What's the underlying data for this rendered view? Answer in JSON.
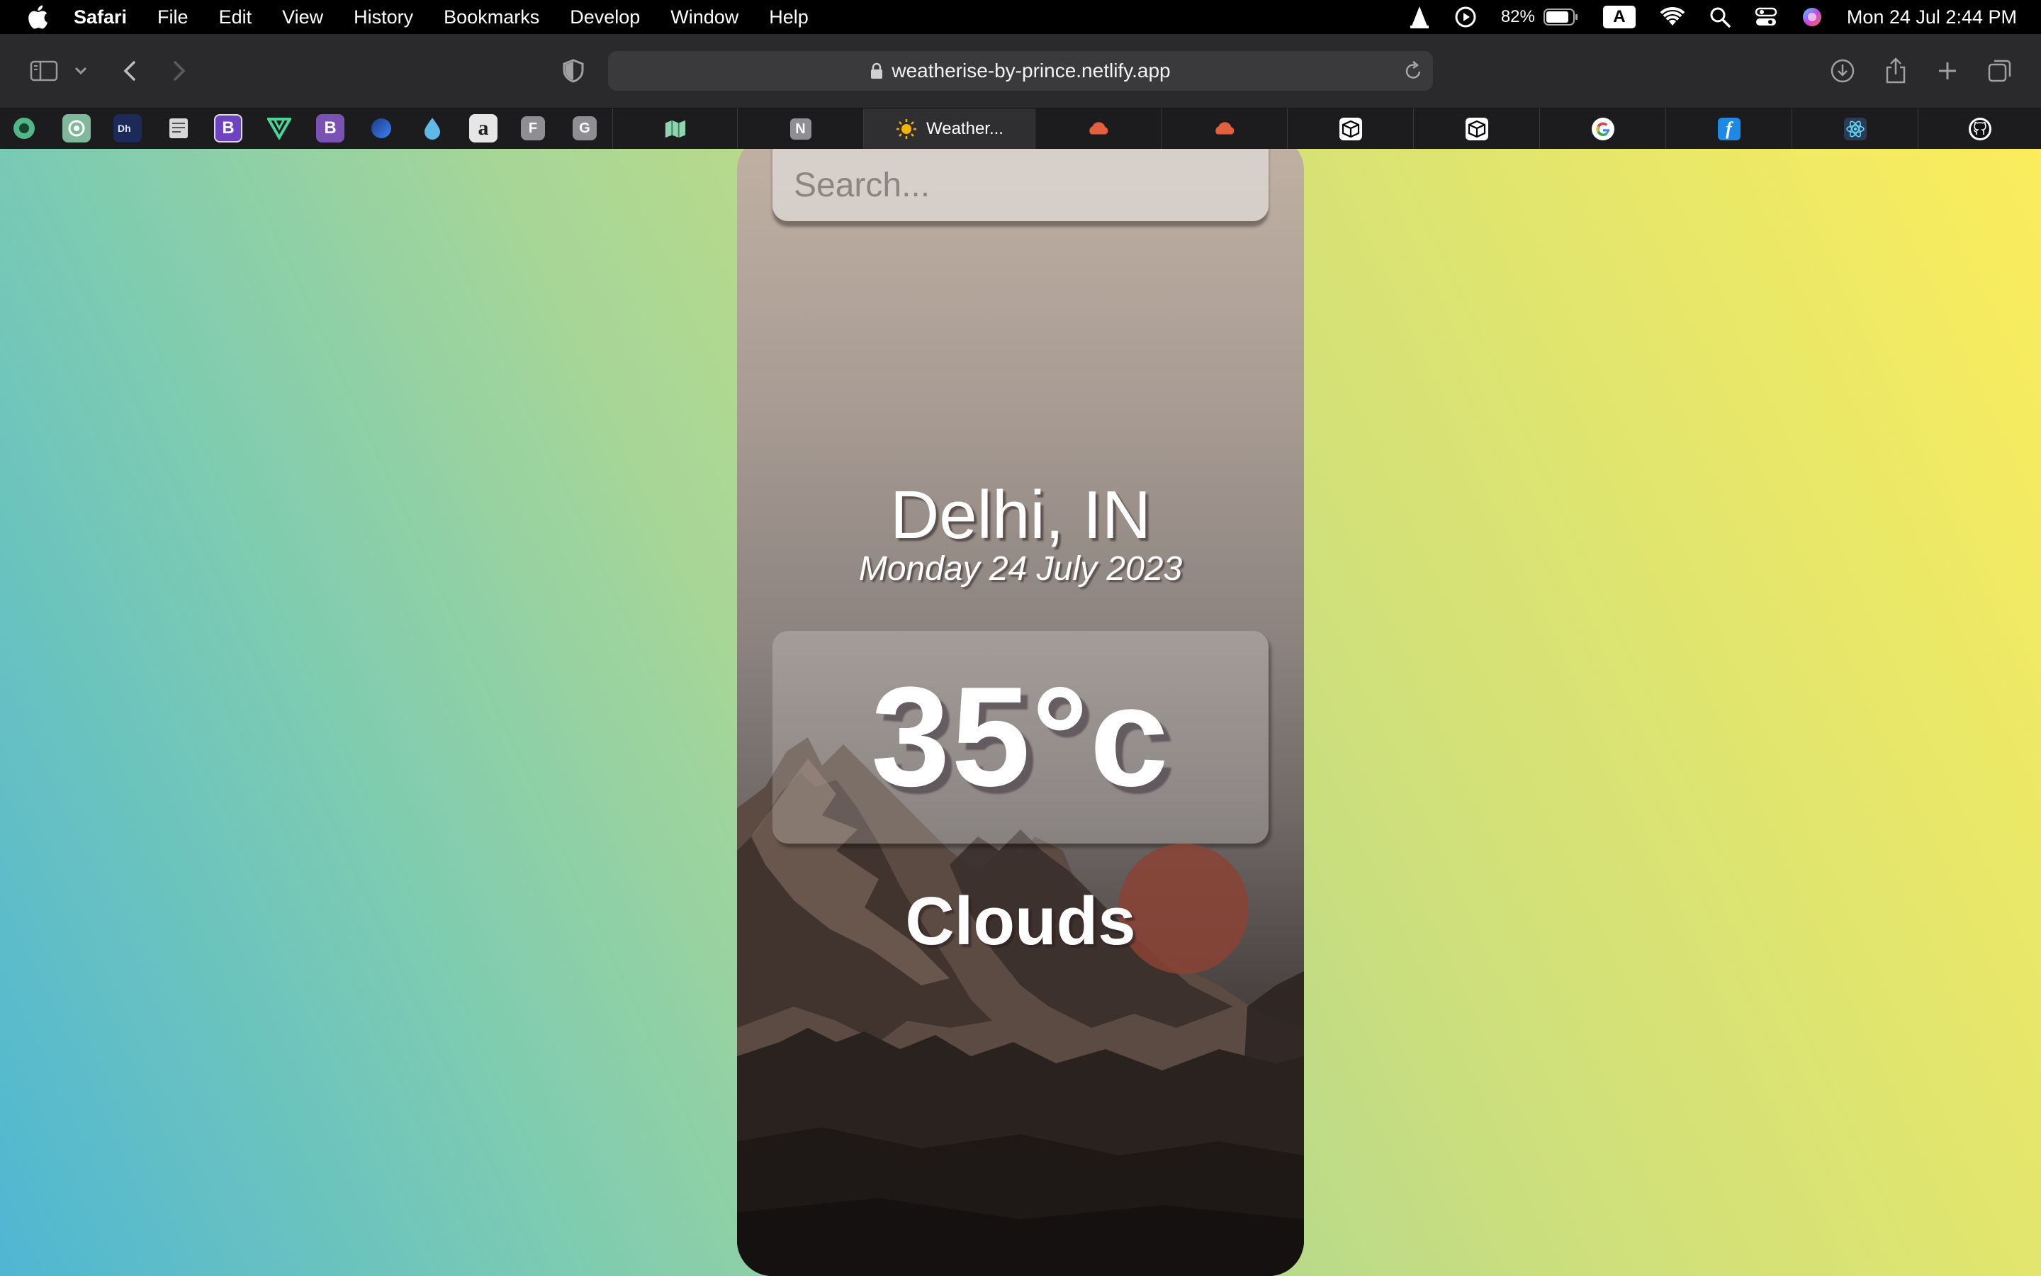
{
  "menubar": {
    "app": "Safari",
    "items": [
      "File",
      "Edit",
      "View",
      "History",
      "Bookmarks",
      "Develop",
      "Window",
      "Help"
    ],
    "battery": "82%",
    "input_source": "A",
    "clock": "Mon 24 Jul  2:44 PM"
  },
  "browser": {
    "url": "weatherise-by-prince.netlify.app",
    "active_tab_title": "Weather...",
    "pinned_tab_letters": [
      "B",
      "B",
      "F",
      "G"
    ],
    "tab_letter_n": "N"
  },
  "app": {
    "search_placeholder": "Search...",
    "location": "Delhi, IN",
    "date": "Monday 24 July 2023",
    "temperature": "35°c",
    "condition": "Clouds"
  },
  "colors": {
    "page_gradient_left": "#4fb6d3",
    "page_gradient_right": "#fbed5c",
    "sun": "#8b4235"
  }
}
